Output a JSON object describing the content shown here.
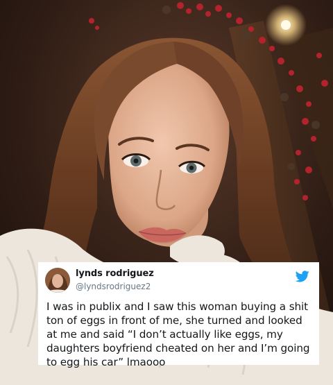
{
  "tweet": {
    "name": "lynds rodriguez",
    "handle": "@lyndsrodriguez2",
    "text": "I was in publix and I saw this woman buying a shit ton of eggs in front of me, she turned and looked at me and said “I don’t actually like eggs, my daughters boyfriend cheated on her and I’m going to egg his car” lmaooo",
    "bird_icon": "twitter-bird-icon",
    "bird_color": "#1da1f2"
  },
  "colors": {
    "background": "#2a1a14",
    "hair": "#7a4a2e",
    "skin": "#e3b39a",
    "sweater": "#ece6dd",
    "berries": "#b3232e"
  }
}
